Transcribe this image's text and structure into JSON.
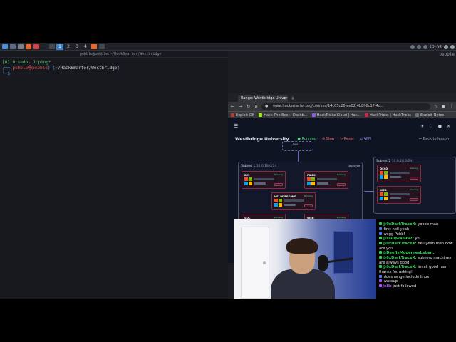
{
  "taskbar": {
    "workspaces": [
      "1",
      "2",
      "3",
      "4"
    ],
    "clock": "12:05"
  },
  "terminal": {
    "title": "pebble@pebble:~/HackSmarter/Westbridge",
    "line1_prefix": "[0] 0:sudo- 1:ping*",
    "line2_prefix": "┌──(",
    "line2_user": "pebble㉿pebble",
    "line2_mid": ")-[",
    "line2_path": "~/HackSmarter/Westbridge",
    "line2_end": "]",
    "line3": "└─$ "
  },
  "right_terminal_label": "pebble",
  "browser": {
    "tab_title": "Range: Westbridge Univer",
    "url": "www.hacksmarter.org/courses/14c05c20-ee02-4b8f-8c17-4c...",
    "bookmarks": [
      "Exploit-DB",
      "Hack The Box :: Dashb...",
      "HackTricks Cloud | Hac...",
      "HackTricks | HackTricks",
      "Exploit Notes"
    ]
  },
  "range": {
    "title": "Westbridge University",
    "running": "Running",
    "stop": "Stop",
    "reset": "Reset",
    "vpn": "VPN",
    "back": "Back to lesson",
    "subnet1": "Subnet 1",
    "subnet1_cidr": "10.0.18.0/24",
    "subnet2": "Subnet 2",
    "subnet2_cidr": "10.0.28.0/24",
    "deployed": "Deployed",
    "machines": [
      {
        "name": "DC",
        "status": "Running",
        "os": "windows"
      },
      {
        "name": "FILES",
        "status": "Running",
        "os": "windows"
      },
      {
        "name": "HELPDESK-WS",
        "status": "Running",
        "os": "windows"
      },
      {
        "name": "SQL",
        "status": "Running",
        "os": "windows"
      },
      {
        "name": "WEB",
        "status": "Running",
        "os": "ubuntu"
      },
      {
        "name": "DC02",
        "status": "Running",
        "os": "windows"
      },
      {
        "name": "WEB",
        "status": "Running",
        "os": "windows"
      }
    ],
    "dc_top_label": "DC01"
  },
  "chat": [
    {
      "user": "@0xDarkTraceX:",
      "color": "green",
      "text": "yoooo man"
    },
    {
      "user": "",
      "color": "blue",
      "text": "first hell yeah"
    },
    {
      "user": "",
      "color": "blue",
      "text": "wsgg Pebb!"
    },
    {
      "user": "@salujwall997:",
      "color": "green",
      "text": "yo"
    },
    {
      "user": "@0xDarkTraceX:",
      "color": "green",
      "text": "hell yeah man how are you"
    },
    {
      "user": "@DeefixModernesLeben:",
      "color": "green",
      "text": ""
    },
    {
      "user": "@0xDarkTraceX:",
      "color": "green",
      "text": "subzero machines are always good"
    },
    {
      "user": "@0xDarkTraceX:",
      "color": "green",
      "text": "im all good man thanks for asking!"
    },
    {
      "user": "",
      "color": "blue",
      "text": "does range include linux"
    },
    {
      "user": "",
      "color": "purple",
      "text": "wassup"
    },
    {
      "user": "Jellb",
      "color": "purple",
      "text": "just followed"
    }
  ]
}
